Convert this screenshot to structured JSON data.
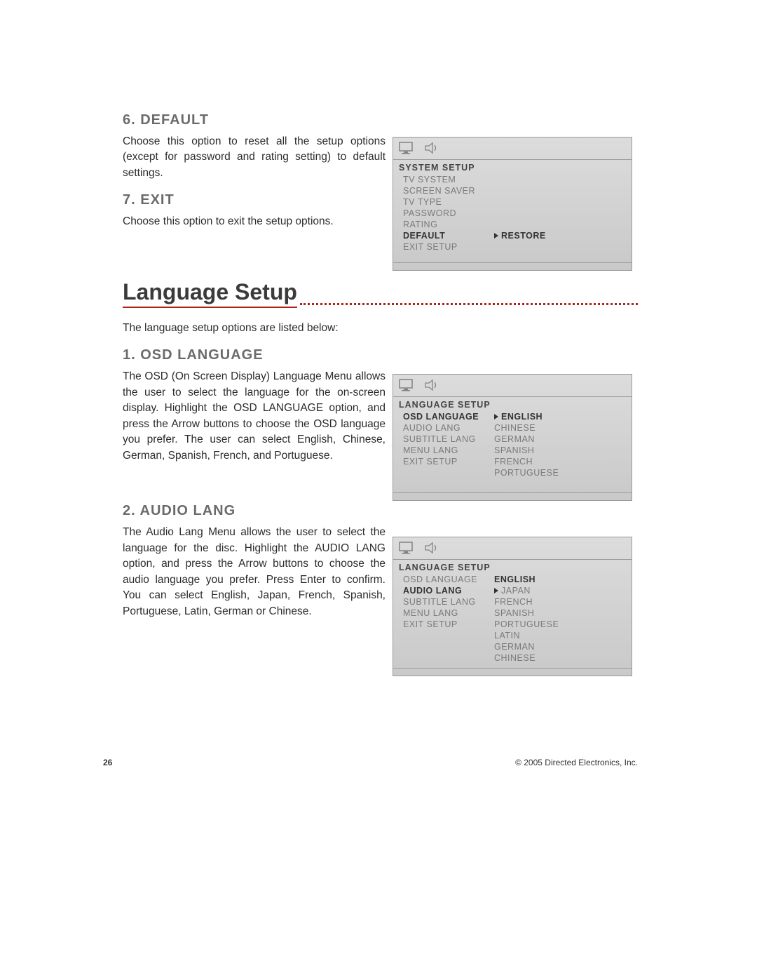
{
  "sections": {
    "default": {
      "heading": "6. DEFAULT",
      "text": "Choose this option to reset all the setup options (except for password and rating setting) to default settings."
    },
    "exit": {
      "heading": "7. EXIT",
      "text": "Choose this option to exit the setup options."
    },
    "lang_title": "Language Setup",
    "lang_intro": "The language setup options are listed below:",
    "osd_lang": {
      "heading": "1. OSD LANGUAGE",
      "text": "The OSD (On Screen Display) Language Menu allows the user to select the language for the on-screen display. Highlight the OSD LANGUAGE option, and press the Arrow buttons to choose the OSD language you prefer. The user can select English, Chinese, German, Spanish, French, and Portuguese."
    },
    "audio_lang": {
      "heading": "2. AUDIO LANG",
      "text": "The Audio Lang Menu allows the user to select the language for the disc. Highlight the AUDIO LANG option, and press the Arrow buttons to choose the audio language you prefer. Press Enter to confirm. You can select English, Japan, French, Spanish, Portuguese, Latin, German or Chinese."
    }
  },
  "osd1": {
    "title": "SYSTEM  SETUP",
    "rows": [
      {
        "l": "TV  SYSTEM",
        "r": "",
        "sel": false,
        "tri": false
      },
      {
        "l": "SCREEN  SAVER",
        "r": "",
        "sel": false,
        "tri": false
      },
      {
        "l": "TV  TYPE",
        "r": "",
        "sel": false,
        "tri": false
      },
      {
        "l": "PASSWORD",
        "r": "",
        "sel": false,
        "tri": false
      },
      {
        "l": "RATING",
        "r": "",
        "sel": false,
        "tri": false
      },
      {
        "l": "DEFAULT",
        "r": "RESTORE",
        "sel": true,
        "tri": true
      },
      {
        "l": "EXIT  SETUP",
        "r": "",
        "sel": false,
        "tri": false
      }
    ]
  },
  "osd2": {
    "title": "LANGUAGE  SETUP",
    "rows": [
      {
        "l": "OSD  LANGUAGE",
        "r": "ENGLISH",
        "sel": true,
        "tri": true
      },
      {
        "l": "AUDIO  LANG",
        "r": "CHINESE",
        "sel": false,
        "tri": false
      },
      {
        "l": "SUBTITLE LANG",
        "r": "GERMAN",
        "sel": false,
        "tri": false
      },
      {
        "l": "MENU  LANG",
        "r": "SPANISH",
        "sel": false,
        "tri": false
      },
      {
        "l": "EXIT  SETUP",
        "r": "FRENCH",
        "sel": false,
        "tri": false
      },
      {
        "l": "",
        "r": "PORTUGUESE",
        "sel": false,
        "tri": false
      }
    ]
  },
  "osd3": {
    "title": "LANGUAGE  SETUP",
    "rows": [
      {
        "l": "OSD  LANGUAGE",
        "r": "ENGLISH",
        "sel": false,
        "tri": false,
        "rb": true
      },
      {
        "l": "AUDIO  LANG",
        "r": "JAPAN",
        "sel": true,
        "tri": true,
        "rightNormal": true
      },
      {
        "l": "SUBTITLE LANG",
        "r": "FRENCH",
        "sel": false,
        "tri": false
      },
      {
        "l": "MENU  LANG",
        "r": "SPANISH",
        "sel": false,
        "tri": false
      },
      {
        "l": "EXIT  SETUP",
        "r": "PORTUGUESE",
        "sel": false,
        "tri": false
      },
      {
        "l": "",
        "r": "LATIN",
        "sel": false,
        "tri": false
      },
      {
        "l": "",
        "r": "GERMAN",
        "sel": false,
        "tri": false
      },
      {
        "l": "",
        "r": "CHINESE",
        "sel": false,
        "tri": false
      }
    ]
  },
  "footer": {
    "page": "26",
    "copyright": "© 2005 Directed Electronics, Inc."
  }
}
